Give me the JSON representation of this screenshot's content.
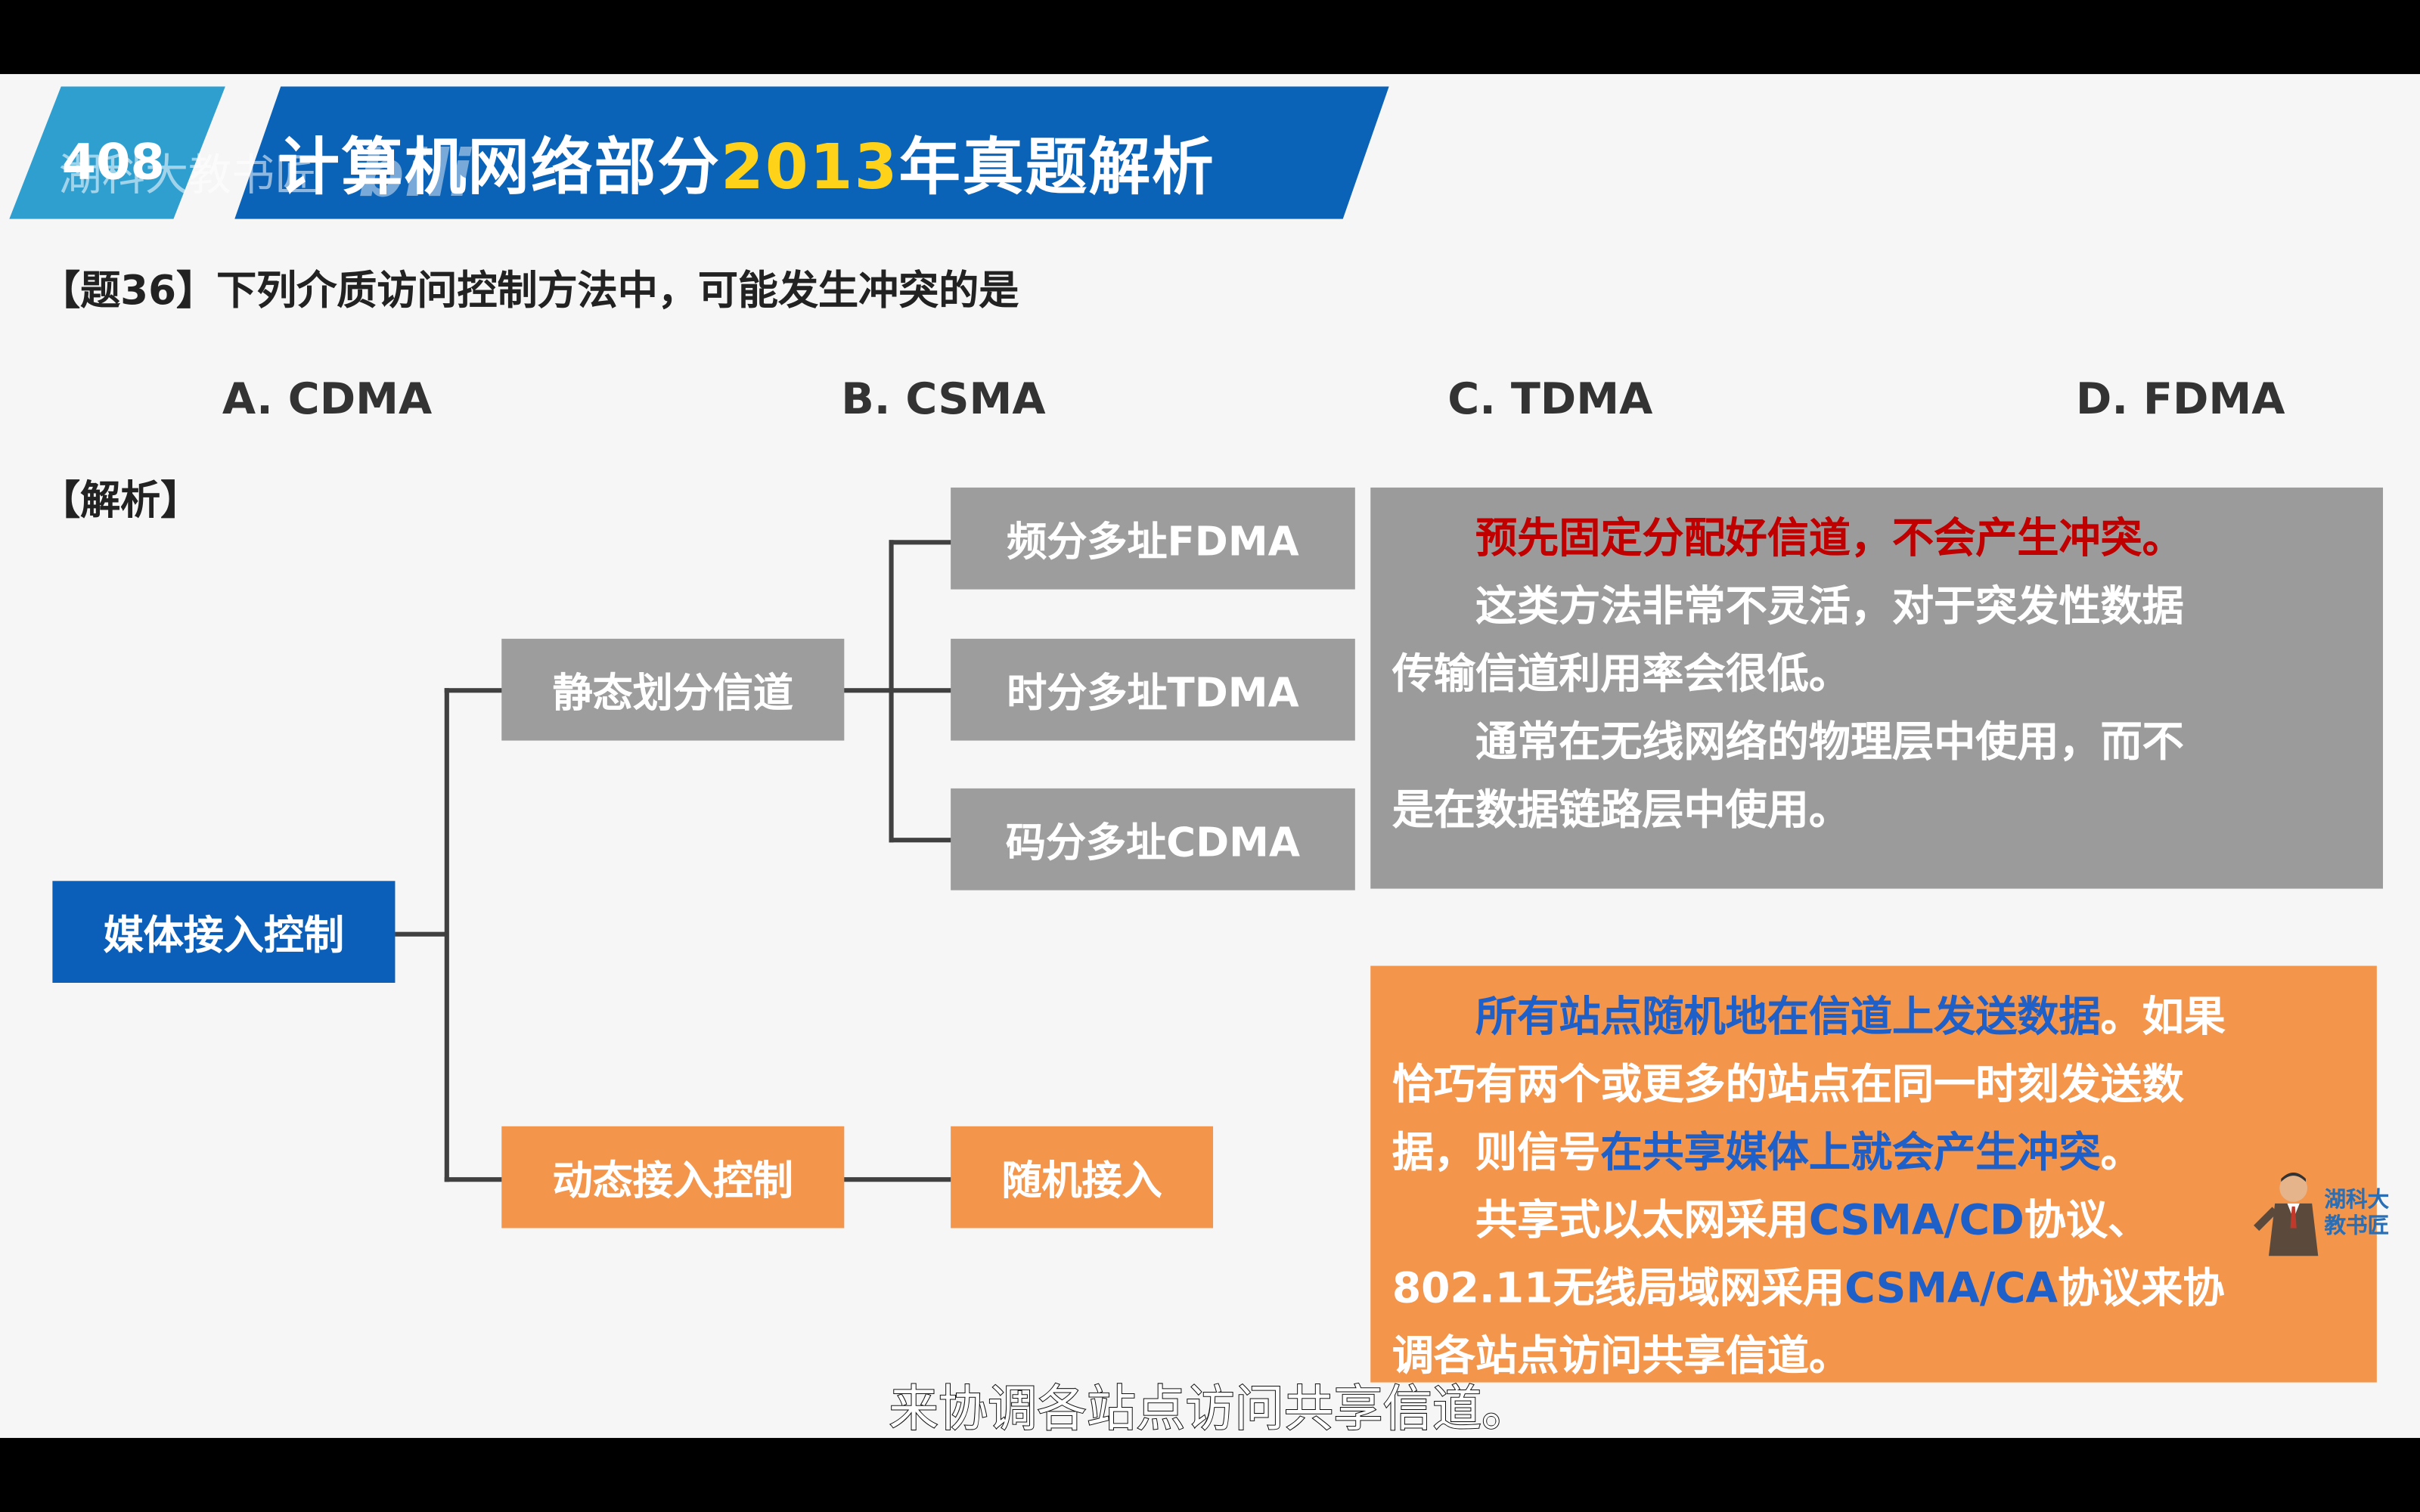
{
  "header": {
    "badge_number": "408",
    "title_prefix": "计算机网络部分",
    "title_year": "2013",
    "title_suffix": "年真题解析",
    "watermark_channel": "湖科大教书匠",
    "watermark_logo": "bili"
  },
  "question": {
    "text": "【题36】下列介质访问控制方法中，可能发生冲突的是",
    "options": [
      "A. CDMA",
      "B. CSMA",
      "C. TDMA",
      "D. FDMA"
    ]
  },
  "analysis_label": "【解析】",
  "tree": {
    "root": "媒体接入控制",
    "static": "静态划分信道",
    "static_children": [
      "频分多址FDMA",
      "时分多址TDMA",
      "码分多址CDMA"
    ],
    "dynamic": "动态接入控制",
    "dynamic_child": "随机接入"
  },
  "static_panel": {
    "line1": "预先固定分配好信道，不会产生冲突。",
    "line2": "这类方法非常不灵活，对于突发性数据",
    "line3": "传输信道利用率会很低。",
    "line4": "通常在无线网络的物理层中使用，而不",
    "line5": "是在数据链路层中使用。"
  },
  "dynamic_panel": {
    "p1_blue": "所有站点随机地在信道上发送数据",
    "p1_a": "。如果",
    "p1_b": "恰巧有两个或更多的站点在同一时刻发送数",
    "p1_c": "据，则信号",
    "p1_blue2": "在共享媒体上就会产生冲突",
    "p1_d": "。",
    "p2_a": "共享式以太网采用",
    "p2_blue": "CSMA/CD",
    "p2_b": "协议、",
    "p2_c": "802.11无线局域网采用",
    "p2_blue2": "CSMA/CA",
    "p2_d": "协议来协",
    "p2_e": "调各站点访问共享信道。"
  },
  "presenter_label": "湖科大教书匠",
  "subtitle": "来协调各站点访问共享信道。",
  "colors": {
    "header_blue": "#0b63b8",
    "header_light_blue": "#2f9fd0",
    "year_yellow": "#ffd21a",
    "node_blue": "#0b5fb8",
    "node_gray": "#9d9d9d",
    "node_orange": "#f3954a",
    "highlight_red": "#c00000",
    "highlight_blue": "#1f5fc8"
  }
}
